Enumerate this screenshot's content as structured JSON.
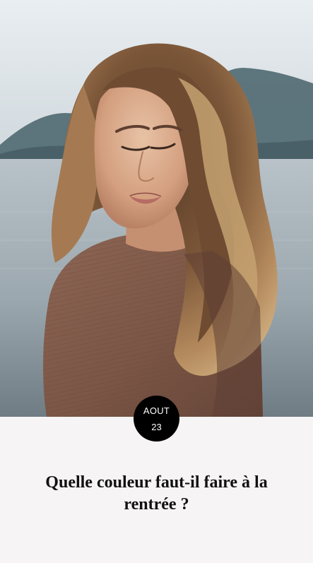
{
  "article": {
    "date": {
      "month": "AOUT",
      "day": "23"
    },
    "title": "Quelle couleur faut-il faire à la rentrée ?"
  },
  "colors": {
    "badge_background": "#000000",
    "badge_text": "#ffffff",
    "title_text": "#111111",
    "card_background": "#f6f4f4"
  }
}
